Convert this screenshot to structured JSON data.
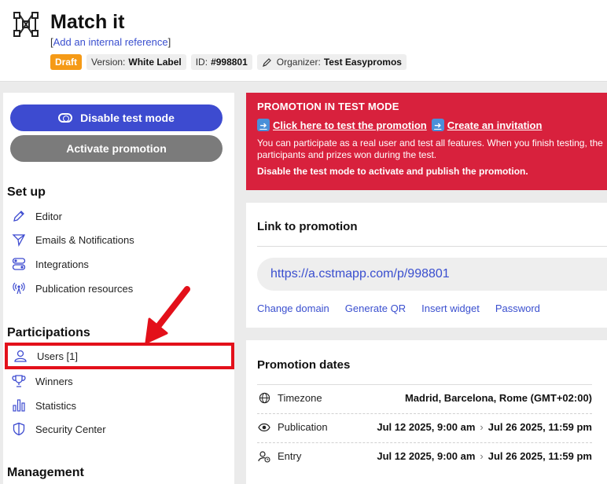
{
  "header": {
    "title": "Match it",
    "ref_open": "[",
    "ref_link": "Add an internal reference",
    "ref_close": "]",
    "badges": {
      "status": "Draft",
      "version_label": "Version:",
      "version_value": "White Label",
      "id_label": "ID:",
      "id_value": "#998801",
      "organizer_label": "Organizer:",
      "organizer_value": "Test Easypromos"
    }
  },
  "sidebar": {
    "disable_test_label": "Disable test mode",
    "activate_label": "Activate promotion",
    "setup_title": "Set up",
    "setup_items": [
      "Editor",
      "Emails & Notifications",
      "Integrations",
      "Publication resources"
    ],
    "participations_title": "Participations",
    "participation_items": [
      "Users [1]",
      "Winners",
      "Statistics",
      "Security Center"
    ],
    "management_title": "Management"
  },
  "alert": {
    "title": "PROMOTION IN TEST MODE",
    "link_test": "Click here to test the promotion",
    "link_invite": "Create an invitation",
    "description": "You can participate as a real user and test all features. When you finish testing, the participants and prizes won during the test.",
    "strong": "Disable the test mode to activate and publish the promotion."
  },
  "link_card": {
    "title": "Link to promotion",
    "url": "https://a.cstmapp.com/p/998801",
    "actions": [
      "Change domain",
      "Generate QR",
      "Insert widget",
      "Password"
    ]
  },
  "dates_card": {
    "title": "Promotion dates",
    "timezone_label": "Timezone",
    "timezone_value": "Madrid, Barcelona, Rome (GMT+02:00)",
    "publication_label": "Publication",
    "publication_start": "Jul 12 2025, 9:00 am",
    "publication_end": "Jul 26 2025, 11:59 pm",
    "entry_label": "Entry",
    "entry_start": "Jul 12 2025, 9:00 am",
    "entry_end": "Jul 26 2025, 11:59 pm"
  },
  "colors": {
    "primary": "#3d4bd0",
    "alert": "#d8213d",
    "draft": "#f59a16",
    "highlight": "#e3101a",
    "link": "#3a4fcf"
  }
}
